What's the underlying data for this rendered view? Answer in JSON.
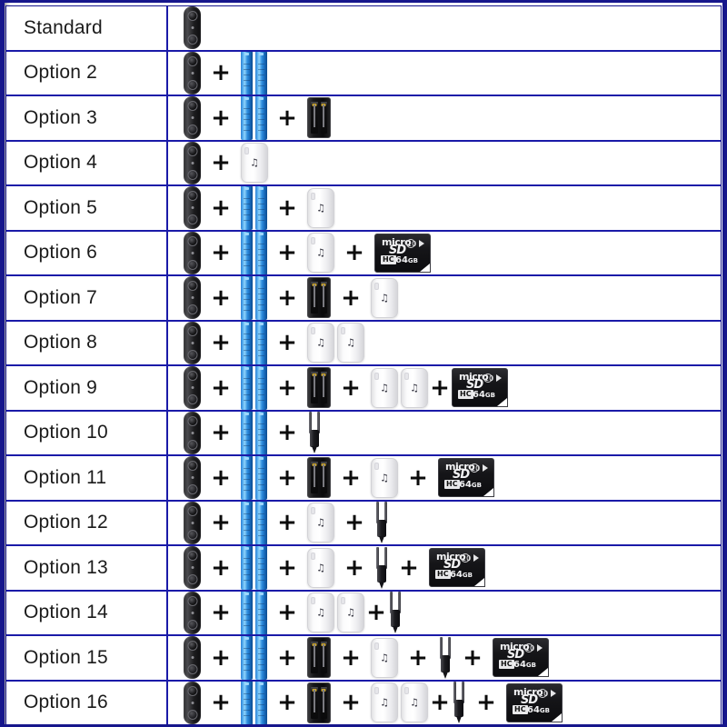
{
  "frame": {
    "border_color": "#16168c",
    "grid_color": "#1a1aa8",
    "background": "#ffffff"
  },
  "icons": {
    "doorbell": "video-doorbell-icon",
    "batteries": "rechargeable-batteries-icon",
    "charger": "battery-charger-icon",
    "chime": "wireless-chime-icon",
    "stake": "mounting-stake-icon",
    "sdcard": "microsd-card-icon",
    "plus": "+"
  },
  "sdcard": {
    "micro": "micro",
    "logo": "SD",
    "class_mark": "10",
    "hc": "HC",
    "capacity": "64",
    "capacity_unit": "GB"
  },
  "chime": {
    "note_glyph": "♫"
  },
  "rows": [
    {
      "label": "Standard",
      "items": [
        "doorbell"
      ]
    },
    {
      "label": "Option 2",
      "items": [
        "doorbell",
        "plus",
        "batteries"
      ]
    },
    {
      "label": "Option 3",
      "items": [
        "doorbell",
        "plus",
        "batteries",
        "plus",
        "charger"
      ]
    },
    {
      "label": "Option 4",
      "items": [
        "doorbell",
        "plus",
        "chime"
      ]
    },
    {
      "label": "Option 5",
      "items": [
        "doorbell",
        "plus",
        "batteries",
        "plus",
        "chime"
      ]
    },
    {
      "label": "Option 6",
      "items": [
        "doorbell",
        "plus",
        "batteries",
        "plus",
        "chime",
        "plus",
        "sdcard"
      ]
    },
    {
      "label": "Option 7",
      "items": [
        "doorbell",
        "plus",
        "batteries",
        "plus",
        "charger",
        "plus",
        "chime"
      ]
    },
    {
      "label": "Option 8",
      "items": [
        "doorbell",
        "plus",
        "batteries",
        "plus",
        "chime2"
      ]
    },
    {
      "label": "Option 9",
      "items": [
        "doorbell",
        "plus",
        "batteries",
        "plus",
        "charger",
        "plus",
        "chime2",
        "plus-tight",
        "sdcard"
      ]
    },
    {
      "label": "Option 10",
      "items": [
        "doorbell",
        "plus",
        "batteries",
        "plus",
        "stake"
      ]
    },
    {
      "label": "Option 11",
      "items": [
        "doorbell",
        "plus",
        "batteries",
        "plus",
        "charger",
        "plus",
        "chime",
        "plus",
        "sdcard"
      ]
    },
    {
      "label": "Option 12",
      "items": [
        "doorbell",
        "plus",
        "batteries",
        "plus",
        "chime",
        "plus",
        "stake"
      ]
    },
    {
      "label": "Option 13",
      "items": [
        "doorbell",
        "plus",
        "batteries",
        "plus",
        "chime",
        "plus",
        "stake",
        "plus",
        "sdcard"
      ]
    },
    {
      "label": "Option 14",
      "items": [
        "doorbell",
        "plus",
        "batteries",
        "plus",
        "chime2",
        "plus-tight",
        "stake"
      ]
    },
    {
      "label": "Option 15",
      "items": [
        "doorbell",
        "plus",
        "batteries",
        "plus",
        "charger",
        "plus",
        "chime",
        "plus",
        "stake",
        "plus",
        "sdcard"
      ]
    },
    {
      "label": "Option 16",
      "items": [
        "doorbell",
        "plus",
        "batteries",
        "plus",
        "charger",
        "plus",
        "chime2",
        "plus-tight",
        "stake",
        "plus",
        "sdcard"
      ]
    }
  ]
}
